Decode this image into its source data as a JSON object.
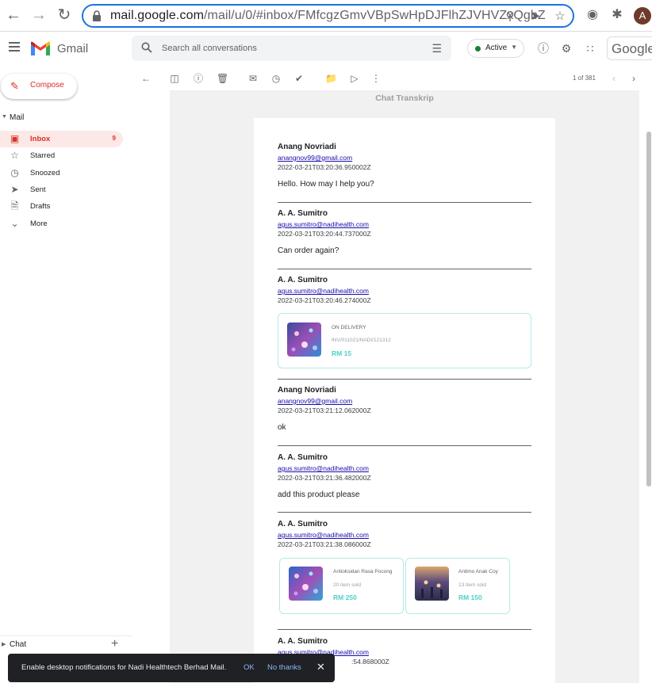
{
  "browser": {
    "url_host": "mail.google.com",
    "url_path": "/mail/u/0/#inbox/FMfcgzGmvVBpSwHpDJFlhZJVHVZxQgbZ",
    "profile_initial": "A"
  },
  "header": {
    "app_name": "Gmail",
    "search_placeholder": "Search all conversations",
    "status_label": "Active",
    "account_label": "Google"
  },
  "sidebar": {
    "compose_label": "Compose",
    "mail_section": "Mail",
    "items": [
      {
        "label": "Inbox",
        "count": "9",
        "icon": "inbox-icon",
        "selected": true
      },
      {
        "label": "Starred",
        "count": "",
        "icon": "star-icon"
      },
      {
        "label": "Snoozed",
        "count": "",
        "icon": "clock-icon"
      },
      {
        "label": "Sent",
        "count": "",
        "icon": "send-icon"
      },
      {
        "label": "Drafts",
        "count": "",
        "icon": "draft-icon"
      },
      {
        "label": "More",
        "count": "",
        "icon": "chevron-down-icon"
      }
    ],
    "chat_section": "Chat"
  },
  "toolbar": {
    "pager": "1 of 381"
  },
  "transcript": {
    "title": "Chat Transkrip",
    "messages": [
      {
        "name": "Anang Novriadi",
        "email": "anangnov99@gmail.com",
        "time": "2022-03-21T03:20:36.950002Z",
        "text": "Hello. How may I help you?"
      },
      {
        "name": "A. A. Sumitro",
        "email": "agus.sumitro@nadihealth.com",
        "time": "2022-03-21T03:20:44.737000Z",
        "text": "Can order again?"
      },
      {
        "name": "A. A. Sumitro",
        "email": "agus.sumitro@nadihealth.com",
        "time": "2022-03-21T03:20:46.274000Z",
        "text": ""
      },
      {
        "name": "Anang Novriadi",
        "email": "anangnov99@gmail.com",
        "time": "2022-03-21T03:21:12.062000Z",
        "text": "ok"
      },
      {
        "name": "A. A. Sumitro",
        "email": "agus.sumitro@nadihealth.com",
        "time": "2022-03-21T03:21:36.482000Z",
        "text": "add this product please"
      },
      {
        "name": "A. A. Sumitro",
        "email": "agus.sumitro@nadihealth.com",
        "time": "2022-03-21T03:21:38.086000Z",
        "text": ""
      },
      {
        "name": "A. A. Sumitro",
        "email": "agus.sumitro@nadihealth.com",
        "time": ":54.868000Z",
        "text": ""
      }
    ],
    "order_card": {
      "status": "ON DELIVERY",
      "invoice": "INV/011021/NADI/121312",
      "price": "RM 15"
    },
    "products": [
      {
        "name": "Antioksidan Rasa Pocong",
        "sold": "20 item sold",
        "price": "RM 250"
      },
      {
        "name": "Antimo Anak Coy",
        "sold": "13 item sold",
        "price": "RM 150"
      }
    ]
  },
  "snackbar": {
    "message": "Enable desktop notifications for Nadi Healthtech Berhad Mail.",
    "ok_label": "OK",
    "no_thanks_label": "No thanks"
  },
  "colors": {
    "accent": "#d93025",
    "link": "#1a0dab",
    "price": "#4dd0c9",
    "card_border": "#b2ebe6"
  }
}
